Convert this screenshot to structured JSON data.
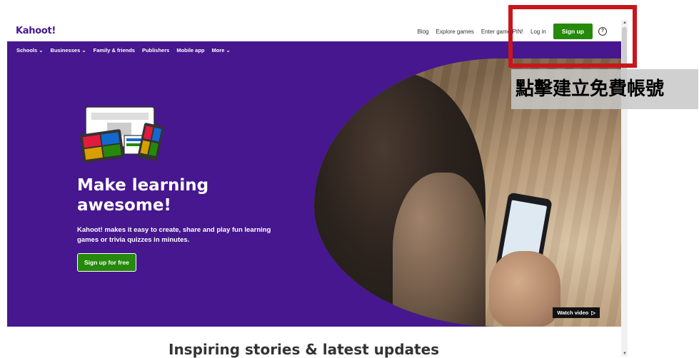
{
  "header": {
    "logo": "Kahoot!",
    "nav": [
      "Blog",
      "Explore games",
      "Enter game PIN!",
      "Log in"
    ],
    "signup": "Sign up",
    "help_icon": "question-circle-icon"
  },
  "subnav": [
    "Schools ⌄",
    "Businesses ⌄",
    "Family & friends",
    "Publishers",
    "Mobile app",
    "More ⌄"
  ],
  "hero": {
    "title": "Make learning awesome!",
    "description": "Kahoot! makes it easy to create, share and play fun learning games or trivia quizzes in minutes.",
    "cta": "Sign up for free",
    "watch_video": "Watch video",
    "accent": "#46178f",
    "button_color": "#26890c"
  },
  "section": {
    "title": "Inspiring stories & latest updates"
  },
  "annotation": {
    "text": "點擊建立免費帳號",
    "box_color": "#c8161d"
  }
}
